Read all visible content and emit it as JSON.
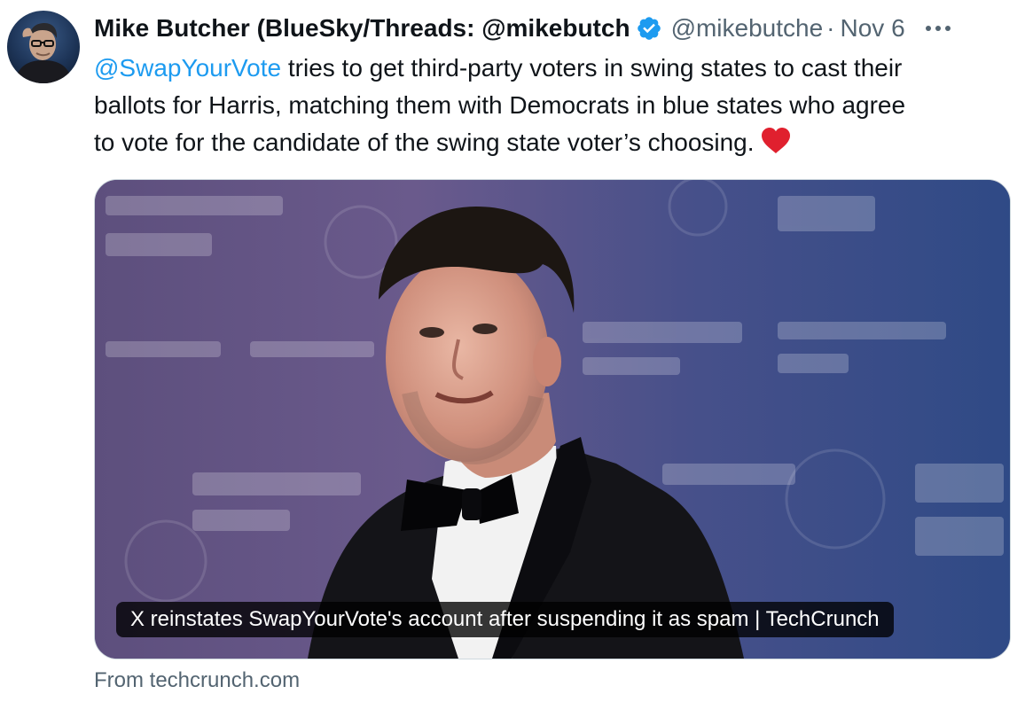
{
  "author": {
    "display_name": "Mike Butcher (BlueSky/Threads: @mikebutch",
    "handle": "@mikebutche",
    "separator": "·",
    "date": "Nov 6",
    "verified": true
  },
  "tweet": {
    "mention": "@SwapYourVote",
    "line1_rest": " tries to get third-party voters in swing states to cast their",
    "line2": "ballots for Harris, matching them with Democrats in blue states who agree",
    "line3": "to vote for the candidate of the swing state voter’s choosing.",
    "emoji": "red-heart"
  },
  "card": {
    "title": "X reinstates SwapYourVote's account after suspending it as spam | TechCrunch",
    "source": "From techcrunch.com"
  },
  "colors": {
    "link": "#1d9bf0",
    "secondary_text": "#536471",
    "verified_badge": "#1d9bf0",
    "heart": "#e0202e",
    "card_border": "#cfd9de"
  },
  "icons": {
    "verified": "verified-badge-icon",
    "more": "more-options-icon",
    "heart": "red-heart-icon"
  }
}
